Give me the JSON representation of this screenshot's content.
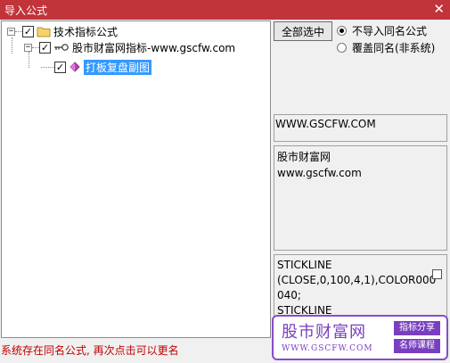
{
  "window": {
    "title": "导入公式",
    "close_glyph": "✕"
  },
  "tree": {
    "root": {
      "label": "技术指标公式",
      "expander": "−",
      "checked": true
    },
    "child": {
      "label": "股市财富网指标-www.gscfw.com",
      "expander": "−",
      "checked": true
    },
    "leaf": {
      "label": "打板复盘副图",
      "checked": true,
      "selected": true
    }
  },
  "options": {
    "select_all_label": "全部选中",
    "radio_skip_label": "不导入同名公式",
    "radio_overwrite_label": "覆盖同名(非系统)",
    "selected": "skip"
  },
  "info": {
    "url": "WWW.GSCFW.COM",
    "description_line1": "股市财富网",
    "description_line2": "www.gscfw.com",
    "code_line1": "STICKLINE",
    "code_line2": "(CLOSE,0,100,4,1),COLOR000",
    "code_line3": "040;",
    "code_line4": "STICKLINE"
  },
  "status": "系统存在同名公式, 再次点击可以更名",
  "watermark": {
    "brand": "股市财富网",
    "url": "WWW.GSCFW.COM",
    "tag1": "指标分享",
    "tag2": "名师课程",
    "colors": {
      "purple": "#7a3fc0"
    }
  },
  "colors": {
    "titlebar": "#c0343a",
    "selection": "#3399ff",
    "status_text": "#c00000"
  }
}
